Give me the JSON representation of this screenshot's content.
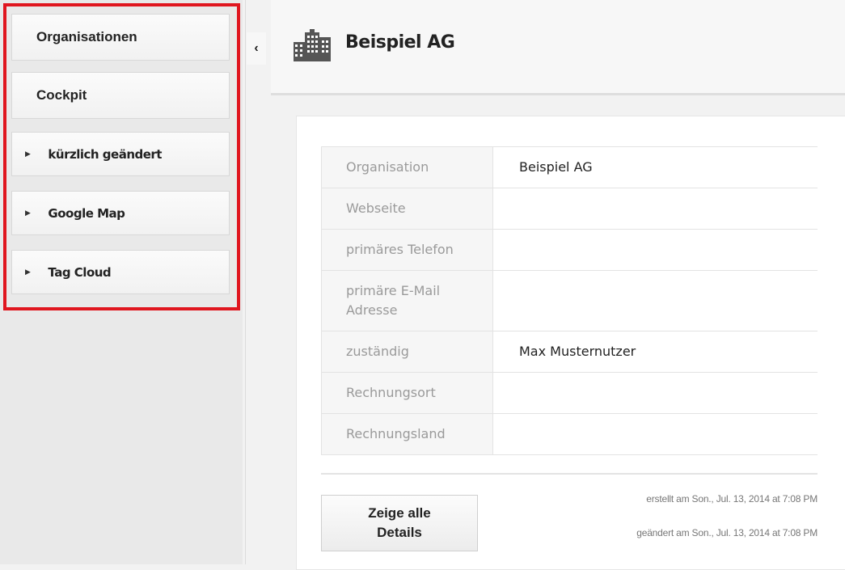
{
  "sidebar": {
    "items": [
      {
        "label": "Organisationen",
        "expandable": false
      },
      {
        "label": "Cockpit",
        "expandable": false
      },
      {
        "label": "kürzlich geändert",
        "expandable": true
      },
      {
        "label": "Google Map",
        "expandable": true
      },
      {
        "label": "Tag Cloud",
        "expandable": true
      }
    ],
    "highlight_color": "#e0161f"
  },
  "collapse_toggle": {
    "glyph": "‹",
    "icon": "chevron-left-icon"
  },
  "header": {
    "title": "Beispiel AG",
    "icon": "building-icon"
  },
  "details": {
    "rows": [
      {
        "key": "Organisation",
        "value": "Beispiel AG"
      },
      {
        "key": "Webseite",
        "value": ""
      },
      {
        "key": "primäres Telefon",
        "value": ""
      },
      {
        "key": "primäre E-Mail Adresse",
        "value": ""
      },
      {
        "key": "zuständig",
        "value": "Max Musternutzer"
      },
      {
        "key": "Rechnungsort",
        "value": ""
      },
      {
        "key": "Rechnungsland",
        "value": ""
      }
    ]
  },
  "footer": {
    "details_button_label": "Zeige alle Details",
    "created": "erstellt am Son., Jul. 13, 2014 at 7:08 PM",
    "modified": "geändert am Son., Jul. 13, 2014 at 7:08 PM"
  }
}
